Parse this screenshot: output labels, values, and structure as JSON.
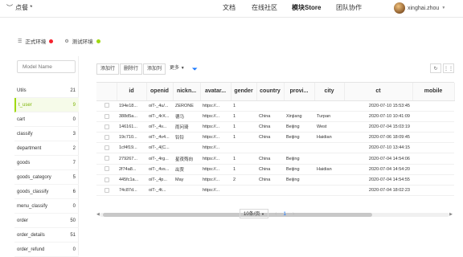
{
  "app": {
    "title": "点餐 *"
  },
  "nav": {
    "docs": "文档",
    "community": "在线社区",
    "store": "模块Store",
    "team": "团队协作"
  },
  "user": {
    "name": "xinghai.zhou"
  },
  "env": {
    "prod_label": "正式环境",
    "prod_color": "#f5222d",
    "test_label": "测试环境",
    "test_color": "#a0d911"
  },
  "sidebar": {
    "search_placeholder": "Model Name",
    "tables": [
      {
        "name": "Utils",
        "count": "21"
      },
      {
        "name": "t_user",
        "count": "9"
      },
      {
        "name": "cart",
        "count": "0"
      },
      {
        "name": "classify",
        "count": "3"
      },
      {
        "name": "department",
        "count": "2"
      },
      {
        "name": "goods",
        "count": "7"
      },
      {
        "name": "goods_category",
        "count": "5"
      },
      {
        "name": "goods_classify",
        "count": "6"
      },
      {
        "name": "menu_classify",
        "count": "0"
      },
      {
        "name": "order",
        "count": "50"
      },
      {
        "name": "order_details",
        "count": "51"
      },
      {
        "name": "order_refund",
        "count": "0"
      }
    ]
  },
  "toolbar": {
    "add_row": "添加行",
    "delete_row": "删除行",
    "add_col": "添加列",
    "more": "更多"
  },
  "grid": {
    "columns": [
      "id",
      "openid",
      "nickn...",
      "avatar...",
      "gender",
      "country",
      "provi...",
      "city",
      "ct",
      "mobile"
    ],
    "rows": [
      [
        "194e18...",
        "oiT-_4u/...",
        "ZERONE",
        "https://...",
        "1",
        "",
        "",
        "",
        "2020-07-10 15:53:45",
        ""
      ],
      [
        "388d5a...",
        "oiT-_4rX...",
        "德马",
        "https://...",
        "1",
        "China",
        "Xinjiang",
        "Turpan",
        "2020-07-10 10:41:09",
        ""
      ],
      [
        "146161...",
        "oiT-_4v...",
        "雨问琦",
        "https://...",
        "1",
        "China",
        "Beijing",
        "West",
        "2020-07-04 15:03:19",
        ""
      ],
      [
        "19c710...",
        "oiT-_4v4...",
        "铃铃",
        "https://...",
        "1",
        "China",
        "Beijing",
        "Haidian",
        "2020-07-06 18:09:45",
        ""
      ],
      [
        "1cf4f19...",
        "oiT-_4(C...",
        "",
        "https://...",
        "",
        "",
        "",
        "",
        "2020-07-10 13:44:15",
        ""
      ],
      [
        "279267...",
        "oiT-_4rg...",
        "星夜殇向",
        "https://...",
        "1",
        "China",
        "Beijing",
        "",
        "2020-07-04 14:54:06",
        ""
      ],
      [
        "2f74a8...",
        "oiT-_4vs...",
        "出贾",
        "https://...",
        "1",
        "China",
        "Beijing",
        "Haidian",
        "2020-07-04 14:54:20",
        ""
      ],
      [
        "445fc1a...",
        "oiT-_4p...",
        "May",
        "https://...",
        "2",
        "China",
        "Beijing",
        "",
        "2020-07-04 14:54:55",
        ""
      ],
      [
        "74c87d...",
        "oiT-_4t...",
        "",
        "https://...",
        "",
        "",
        "",
        "",
        "2020-07-04 18:02:23",
        ""
      ]
    ]
  },
  "pager": {
    "size": "10条/页",
    "current": "1"
  }
}
